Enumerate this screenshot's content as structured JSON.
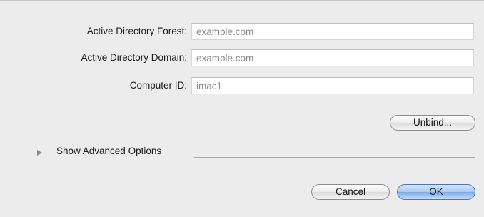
{
  "fields": [
    {
      "label": "Active Directory Forest:",
      "value": "example.com"
    },
    {
      "label": "Active Directory Domain:",
      "value": "example.com"
    },
    {
      "label": "Computer ID:",
      "value": "imac1"
    }
  ],
  "unbind_label": "Unbind...",
  "advanced": {
    "label": "Show Advanced Options"
  },
  "buttons": {
    "cancel": "Cancel",
    "ok": "OK"
  }
}
